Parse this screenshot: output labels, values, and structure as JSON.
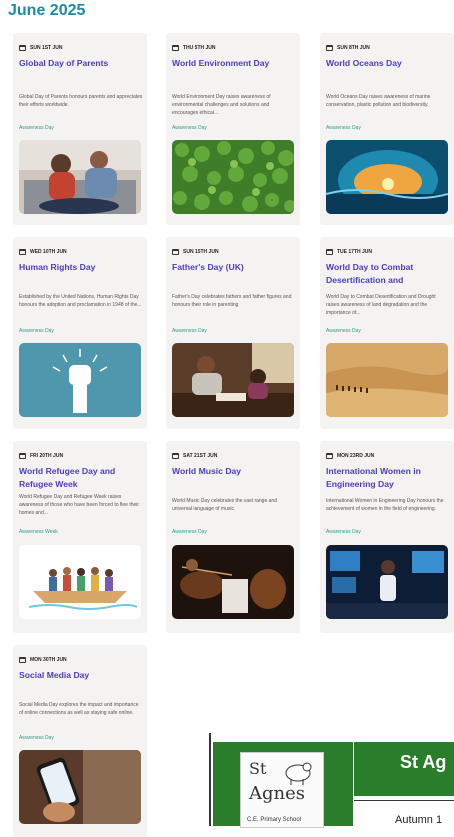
{
  "month_title": "June 2025",
  "events": [
    {
      "date": "SUN 1ST JUN",
      "title": "Global Day of Parents",
      "desc": "Global Day of Parents honours parents and appreciates their efforts worldwide.",
      "tag": "Awareness Day",
      "image": "family-photo"
    },
    {
      "date": "THU 5TH JUN",
      "title": "World Environment Day",
      "desc": "World Environment Day raises awareness of environmental challenges and solutions and encourages ethical...",
      "tag": "Awareness Day",
      "image": "leaves-photo"
    },
    {
      "date": "SUN 8TH JUN",
      "title": "World Oceans Day",
      "desc": "World Oceans Day raises awareness of marine conservation, plastic pollution and biodiversity.",
      "tag": "Awareness Day",
      "image": "ocean-wave-photo"
    },
    {
      "date": "WED 10TH JUN",
      "title": "Human Rights Day",
      "desc": "Established by the United Nations, Human Rights Day honours the adoption and proclamation in 1948 of the...",
      "tag": "Awareness Day",
      "image": "raised-fist-illustration"
    },
    {
      "date": "SUN 15TH JUN",
      "title": "Father's Day (UK)",
      "desc": "Father's Day celebrates fathers and father figures and honours their role in parenting",
      "tag": "Awareness Day",
      "image": "father-child-photo"
    },
    {
      "date": "TUE 17TH JUN",
      "title": "World Day to Combat Desertification and",
      "desc": "World Day to Combat Desertification and Drought raises awareness of land degradation and the importance of...",
      "tag": "Awareness Day",
      "image": "desert-photo"
    },
    {
      "date": "FRI 20TH JUN",
      "title": "World Refugee Day and Refugee Week",
      "desc": "World Refugee Day and Refugee Week raises awareness of those who have been forced to flee their homes and...",
      "tag": "Awareness Week",
      "image": "refugee-boat-illustration"
    },
    {
      "date": "SAT 21ST JUN",
      "title": "World Music Day",
      "desc": "World Music Day celebrates the vast range and universal language of music.",
      "tag": "Awareness Day",
      "image": "orchestra-photo"
    },
    {
      "date": "MON 23RD JUN",
      "title": "International Women in Engineering Day",
      "desc": "International Women in Engineering Day honours the achievement of women in the field of engineering.",
      "tag": "Awareness Day",
      "image": "engineer-photo"
    },
    {
      "date": "MON 30TH JUN",
      "title": "Social Media Day",
      "desc": "Social Media Day explores the impact and importance of online connections as well as staying safe online.",
      "tag": "Awareness Day",
      "image": "smartphone-photo"
    }
  ],
  "school": {
    "logo_st": "St",
    "logo_agnes": "Agnes",
    "logo_sub": "C.E. Primary School",
    "name": "St Ag",
    "term": "Autumn 1"
  },
  "colors": {
    "title": "#1a8aa6",
    "card_title": "#4b3cc9",
    "tag": "#2a9a8f",
    "card_bg": "#f5f3f1",
    "school_green": "#2a7d2a"
  }
}
